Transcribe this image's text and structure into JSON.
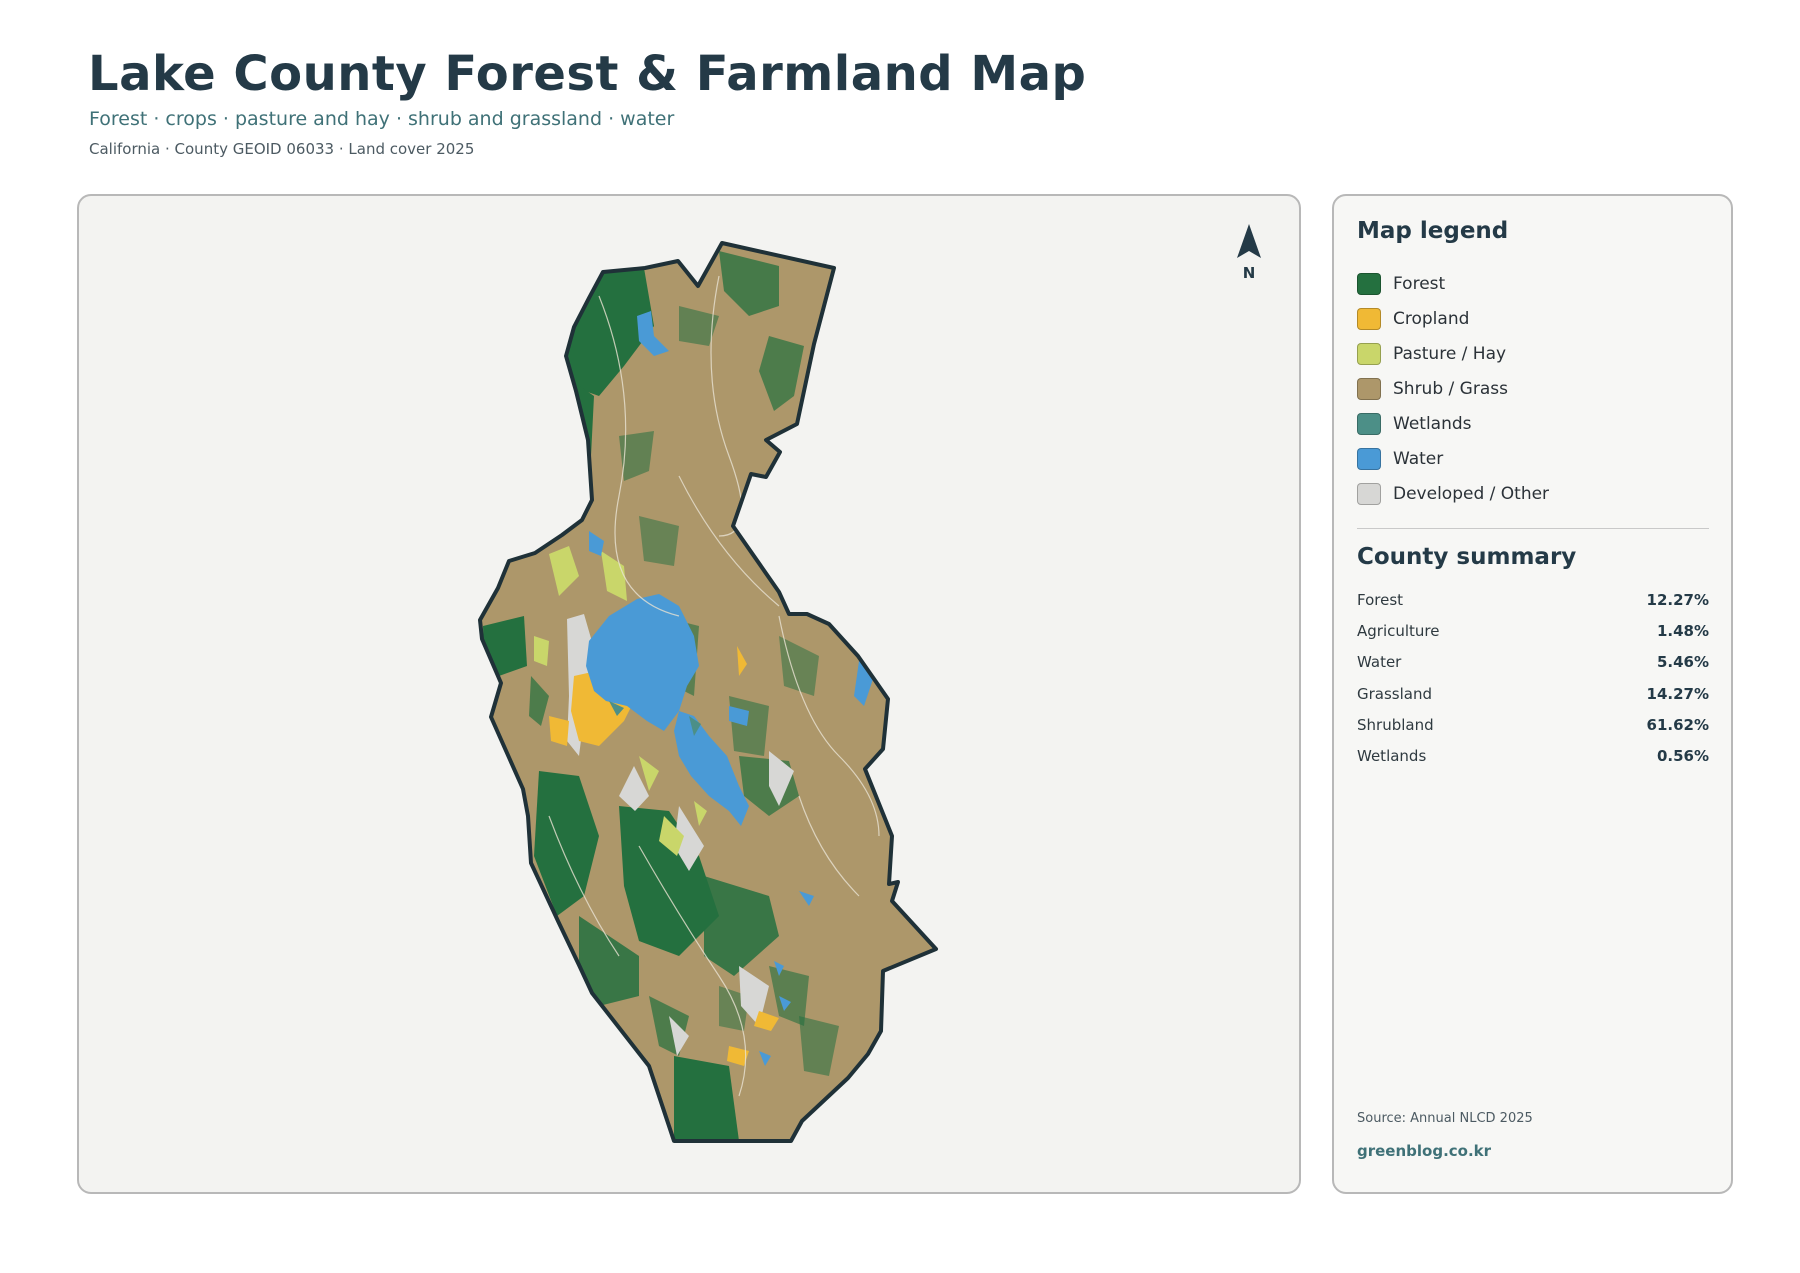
{
  "header": {
    "title": "Lake County Forest & Farmland Map",
    "subtitle": "Forest · crops · pasture and hay · shrub and grassland · water",
    "meta": "California · County GEOID 06033 · Land cover 2025"
  },
  "map": {
    "north_label": "N",
    "colors": {
      "forest": "#24703f",
      "cropland": "#f0b935",
      "pasture": "#c9d66a",
      "shrub_grass": "#ad976a",
      "wetlands": "#4c8f87",
      "water": "#4a9ad6",
      "developed": "#d7d7d5",
      "outline": "#1f3138",
      "panel_bg": "#f3f3f1"
    }
  },
  "legend": {
    "title": "Map legend",
    "items": [
      {
        "label": "Forest",
        "color": "#24703f"
      },
      {
        "label": "Cropland",
        "color": "#f0b935"
      },
      {
        "label": "Pasture / Hay",
        "color": "#c9d66a"
      },
      {
        "label": "Shrub / Grass",
        "color": "#ad976a"
      },
      {
        "label": "Wetlands",
        "color": "#4c8f87"
      },
      {
        "label": "Water",
        "color": "#4a9ad6"
      },
      {
        "label": "Developed / Other",
        "color": "#d7d7d5"
      }
    ]
  },
  "summary": {
    "title": "County summary",
    "rows": [
      {
        "name": "Forest",
        "value": "12.27%"
      },
      {
        "name": "Agriculture",
        "value": "1.48%"
      },
      {
        "name": "Water",
        "value": "5.46%"
      },
      {
        "name": "Grassland",
        "value": "14.27%"
      },
      {
        "name": "Shrubland",
        "value": "61.62%"
      },
      {
        "name": "Wetlands",
        "value": "0.56%"
      }
    ]
  },
  "footer": {
    "source": "Source: Annual NLCD 2025",
    "credit": "greenblog.co.kr"
  }
}
